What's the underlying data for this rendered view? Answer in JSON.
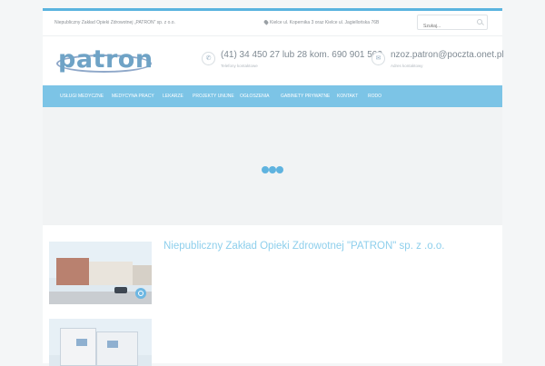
{
  "topbar": {
    "company_short": "Niepubliczny Zakład Opieki Zdrowotnej „PATRON” sp. z o.o.",
    "address": "Kielce ul. Kopernika 3 oraz Kielce ul. Jagiellońska 76B",
    "search_placeholder": "Szukaj..."
  },
  "logo": {
    "text": "patron"
  },
  "contacts": {
    "phone": {
      "main": "(41) 34 450 27 lub 28 kom. 690 901 502",
      "sub": "Telefony kontaktowe"
    },
    "email": {
      "main": "nzoz.patron@poczta.onet.pl",
      "sub": "Adres kontaktowy"
    }
  },
  "nav": {
    "items": [
      "USŁUGI MEDYCZNE",
      "MEDYCYNA PRACY",
      "LEKARZE",
      "PROJEKTY UNIJNE",
      "OGŁOSZENIA",
      "GABINETY PRYWATNE",
      "KONTAKT",
      "RODO"
    ]
  },
  "colors": {
    "accent": "#7cc4e6",
    "title": "#8ecfec",
    "loader": "#5fb3df"
  },
  "main": {
    "post_title": "Niepubliczny Zakład Opieki Zdrowotnej \"PATRON\" sp. z .o.o."
  }
}
